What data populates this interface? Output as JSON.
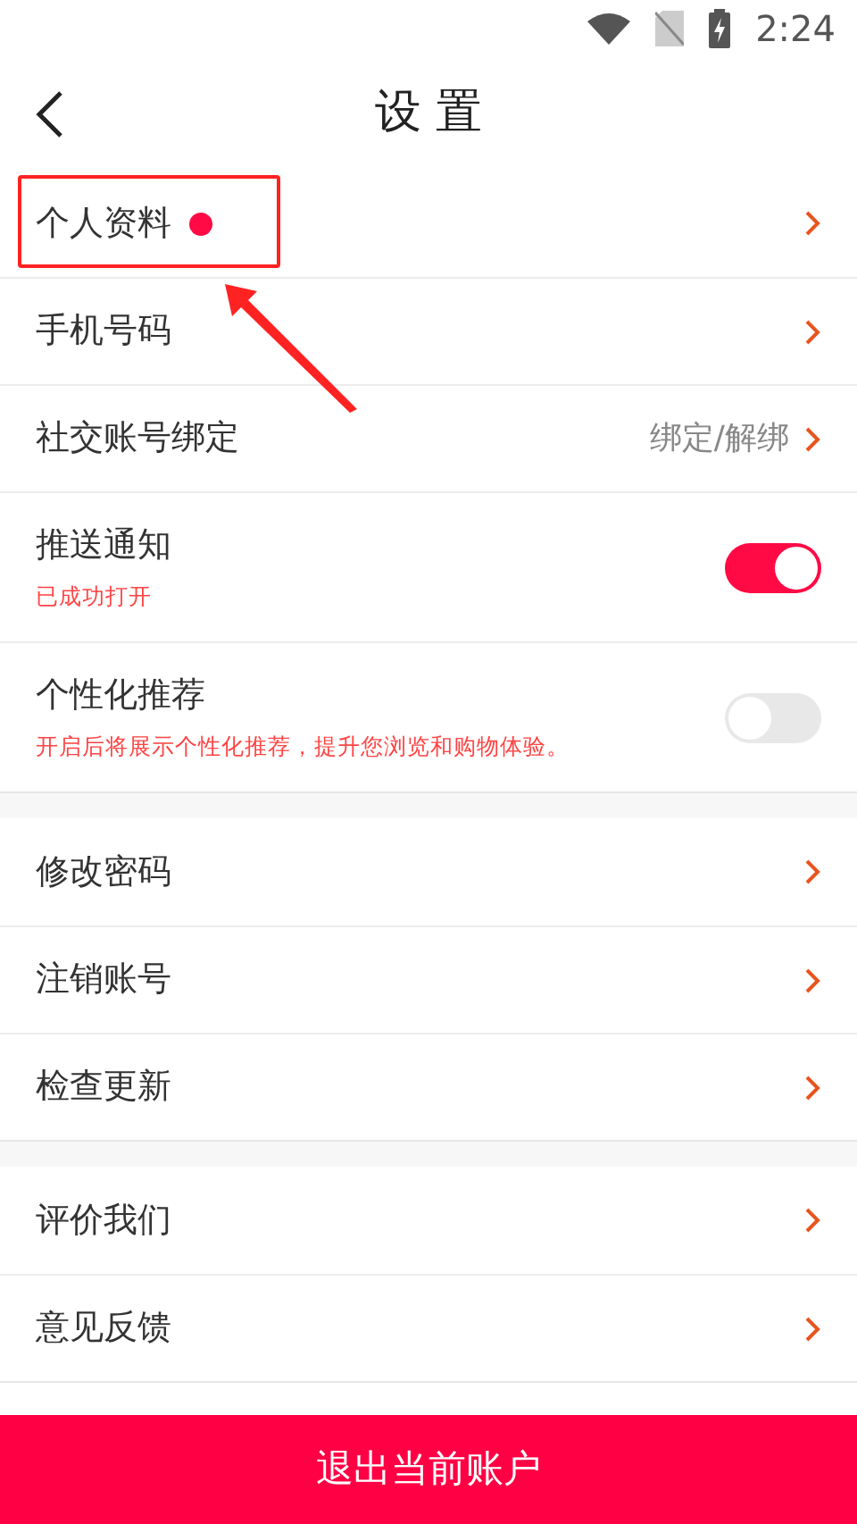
{
  "status_bar": {
    "time": "2:24"
  },
  "header": {
    "title": "设 置"
  },
  "sections": [
    {
      "items": [
        {
          "kind": "link",
          "label": "个人资料",
          "dot": true,
          "annotated": true
        },
        {
          "kind": "link",
          "label": "手机号码"
        },
        {
          "kind": "link",
          "label": "社交账号绑定",
          "value": "绑定/解绑"
        },
        {
          "kind": "toggle",
          "label": "推送通知",
          "note": "已成功打开",
          "on": true
        },
        {
          "kind": "toggle",
          "label": "个性化推荐",
          "note": "开启后将展示个性化推荐，提升您浏览和购物体验。",
          "on": false
        }
      ]
    },
    {
      "items": [
        {
          "kind": "link",
          "label": "修改密码"
        },
        {
          "kind": "link",
          "label": "注销账号"
        },
        {
          "kind": "link",
          "label": "检查更新"
        }
      ]
    },
    {
      "items": [
        {
          "kind": "link",
          "label": "评价我们"
        },
        {
          "kind": "link",
          "label": "意见反馈"
        }
      ]
    }
  ],
  "logout_button": {
    "label": "退出当前账户"
  }
}
